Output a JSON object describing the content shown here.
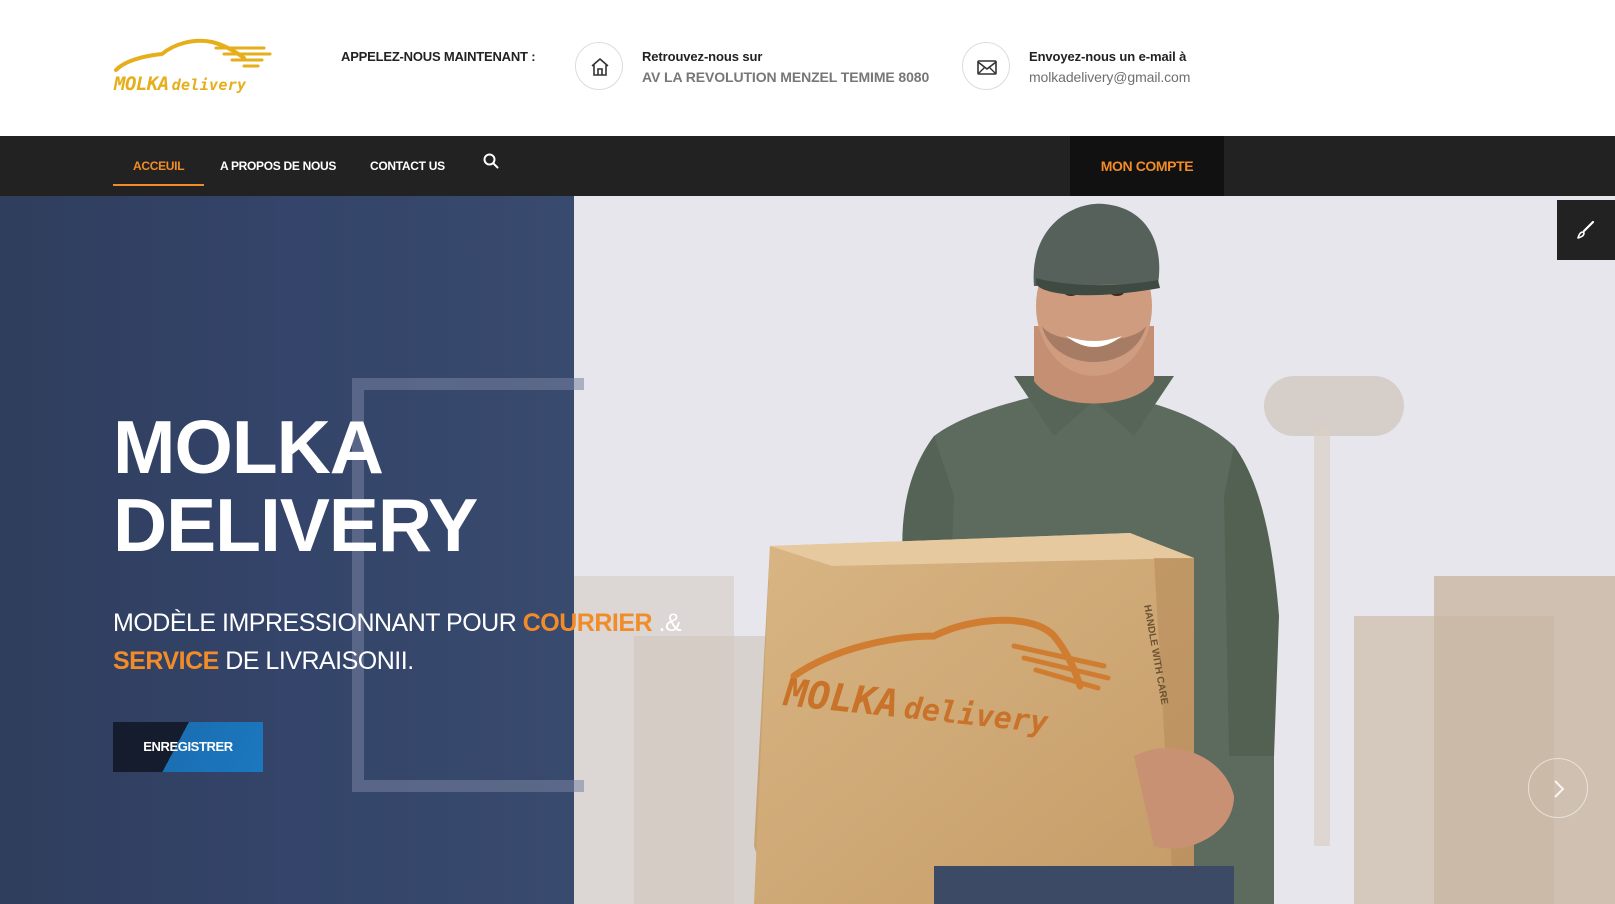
{
  "brand": {
    "logo_word1": "MOLKA",
    "logo_word2": "delivery",
    "logo_color": "#e7ae1b"
  },
  "header": {
    "call_label": "APPELEZ-NOUS MAINTENANT :",
    "address": {
      "title": "Retrouvez-nous sur",
      "value": "AV LA REVOLUTION MENZEL TEMIME 8080",
      "icon": "home-icon"
    },
    "email": {
      "title": "Envoyez-nous un e-mail à",
      "value": "molkadelivery@gmail.com",
      "icon": "mail-icon"
    }
  },
  "nav": {
    "items": [
      {
        "label": "ACCEUIL",
        "active": true
      },
      {
        "label": "A PROPOS DE NOUS",
        "active": false
      },
      {
        "label": "CONTACT US",
        "active": false
      }
    ],
    "search_icon": "search-icon",
    "account_label": "MON COMPTE",
    "accent": "#f28c28"
  },
  "hero": {
    "title_line1": "MOLKA",
    "title_line2": "DELIVERY",
    "sub_part1": "MODÈLE IMPRESSIONNANT POUR ",
    "sub_hl1": "COURRIER",
    "sub_part2": " .&",
    "sub_hl2": "SERVICE",
    "sub_part3": " DE LIVRAISONII.",
    "button_label": "ENREGISTRER",
    "box_logo_word1": "MOLKA",
    "box_logo_word2": "delivery",
    "box_side_text": "HANDLE WITH CARE",
    "tool_icon": "brush-icon",
    "next_icon": "chevron-right-icon"
  }
}
